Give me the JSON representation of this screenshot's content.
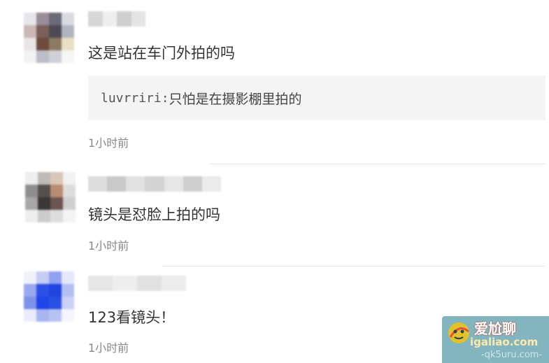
{
  "comments": [
    {
      "text": "这是站在车门外拍的吗",
      "reply": {
        "name": "luvrriri",
        "separator": ":",
        "text": "只怕是在摄影棚里拍的"
      },
      "time": "1小时前",
      "avatar_colors": [
        "#e6e6ea",
        "#9a8c98",
        "#6b6b78",
        "#d9d9e0",
        "#c9b8b4",
        "#7a5f5a",
        "#4e4a55",
        "#b0b4c0",
        "#e8e4e6",
        "#6e4b3e",
        "#8a7a63",
        "#e9dfc4",
        "#f2f2f2",
        "#bdbdc7",
        "#cfcfd6",
        "#f5f5f5"
      ],
      "username_colors": [
        "#d6d6d6",
        "#eeeeee",
        "#cfcfcf",
        "#e4e4e4"
      ]
    },
    {
      "text": "镜头是怼脸上拍的吗",
      "time": "1小时前",
      "avatar_colors": [
        "#eeeeee",
        "#bfbab6",
        "#d8c6b8",
        "#f1f1f1",
        "#8f8d8e",
        "#55504c",
        "#b98b72",
        "#dcdcdc",
        "#a8a6a6",
        "#393737",
        "#6b5550",
        "#cfcfcf",
        "#eeeeee",
        "#cccccc",
        "#dddddd",
        "#f3f3f3"
      ],
      "username_colors": [
        "#dcdcdc",
        "#c9c9c9",
        "#e1e1e1",
        "#d3d3d3",
        "#e6e6e6",
        "#cfcfcf",
        "#eaeaea"
      ]
    },
    {
      "text": "123看镜头！",
      "time": "1小时前",
      "avatar_colors": [
        "#f0f2fb",
        "#c5cdf3",
        "#8fa0ef",
        "#e4e8fa",
        "#9aa8ef",
        "#2c4fe6",
        "#1f44e0",
        "#b3bff3",
        "#7f92ea",
        "#1e45e6",
        "#2a4fe4",
        "#c9d1f5",
        "#e9ecfb",
        "#a8b5f1",
        "#b7c2f3",
        "#f3f5fc"
      ],
      "username_colors": [
        "#e6e6e6",
        "#eeeeee",
        "#e1e1e1",
        "#ececec"
      ]
    }
  ],
  "watermark": {
    "title": "爱尬聊",
    "url": "igaliao.com",
    "url2": "-qk5uru.com-"
  }
}
